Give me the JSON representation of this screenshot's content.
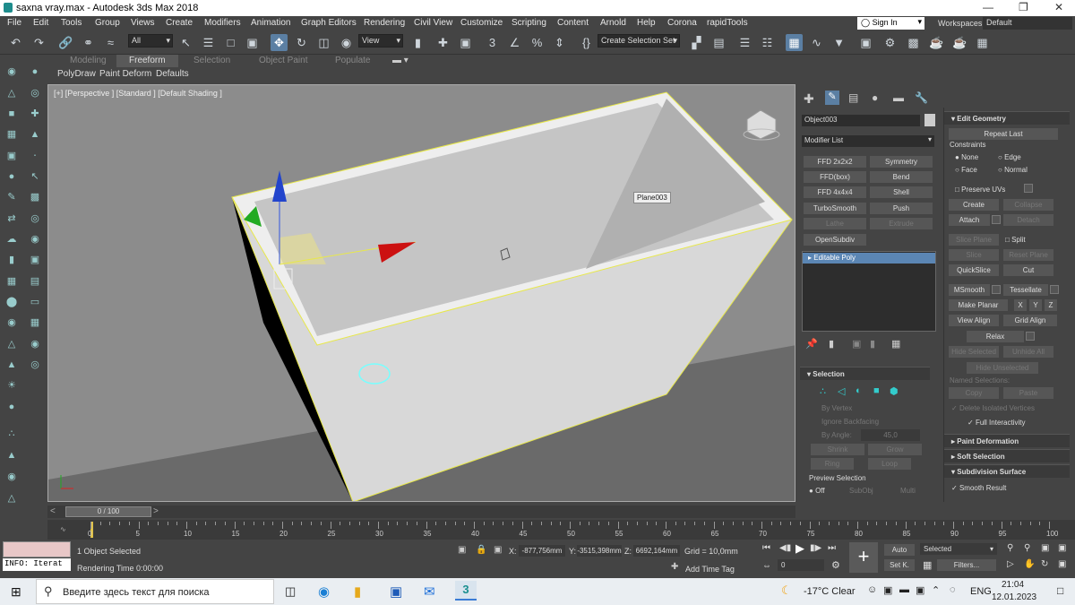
{
  "window": {
    "title": "saxna vray.max - Autodesk 3ds Max 2018"
  },
  "menu": [
    "File",
    "Edit",
    "Tools",
    "Group",
    "Views",
    "Create",
    "Modifiers",
    "Animation",
    "Graph Editors",
    "Rendering",
    "Civil View",
    "Customize",
    "Scripting",
    "Content",
    "Arnold",
    "Help",
    "Corona",
    "rapidTools"
  ],
  "account": {
    "signin": "Sign In",
    "workspaces_label": "Workspaces:",
    "workspace": "Default"
  },
  "toolbar": {
    "filter": "All",
    "view": "View",
    "selection_set": "Create Selection Set"
  },
  "ribbon": {
    "tabs": [
      "Modeling",
      "Freeform",
      "Selection",
      "Object Paint",
      "Populate"
    ],
    "subtabs": [
      "PolyDraw",
      "Paint Deform",
      "Defaults"
    ]
  },
  "viewport": {
    "label": "[+] [Perspective ] [Standard ] [Default Shading ]",
    "tooltip": "Plane003"
  },
  "command_panel": {
    "object_name": "Object003",
    "modifier_list": "Modifier List",
    "buttons": [
      [
        "FFD 2x2x2",
        "Symmetry"
      ],
      [
        "FFD(box)",
        "Bend"
      ],
      [
        "FFD 4x4x4",
        "Shell"
      ],
      [
        "TurboSmooth",
        "Push"
      ],
      [
        "Lathe",
        "Extrude"
      ],
      [
        "OpenSubdiv",
        ""
      ]
    ],
    "stack_item": "Editable Poly",
    "selection": {
      "title": "Selection",
      "by_vertex": "By Vertex",
      "ignore_backfacing": "Ignore Backfacing",
      "by_angle": "By Angle:",
      "angle": "45,0",
      "shrink": "Shrink",
      "grow": "Grow",
      "ring": "Ring",
      "loop": "Loop",
      "preview": "Preview Selection",
      "off": "Off",
      "subobj": "SubObj",
      "multi": "Multi"
    }
  },
  "edit_geometry": {
    "title": "Edit Geometry",
    "repeat_last": "Repeat Last",
    "constraints": "Constraints",
    "none": "None",
    "edge": "Edge",
    "face": "Face",
    "normal": "Normal",
    "preserve_uvs": "Preserve UVs",
    "create": "Create",
    "collapse": "Collapse",
    "attach": "Attach",
    "detach": "Detach",
    "slice_plane": "Slice Plane",
    "split": "Split",
    "slice": "Slice",
    "reset_plane": "Reset Plane",
    "quickslice": "QuickSlice",
    "cut": "Cut",
    "msmooth": "MSmooth",
    "tessellate": "Tessellate",
    "make_planar": "Make Planar",
    "x": "X",
    "y": "Y",
    "z": "Z",
    "view_align": "View Align",
    "grid_align": "Grid Align",
    "relax": "Relax",
    "hide_selected": "Hide Selected",
    "unhide_all": "Unhide All",
    "hide_unselected": "Hide Unselected",
    "named_selections": "Named Selections:",
    "copy": "Copy",
    "paste": "Paste",
    "delete_isolated": "Delete Isolated Vertices",
    "full_interactivity": "Full Interactivity"
  },
  "rollouts": {
    "paint_deformation": "Paint Deformation",
    "soft_selection": "Soft Selection",
    "subdivision_surface": "Subdivision Surface",
    "smooth_result": "Smooth Result"
  },
  "timeline": {
    "frame": "0 / 100",
    "ticks": [
      "0",
      "5",
      "10",
      "15",
      "20",
      "25",
      "30",
      "35",
      "40",
      "45",
      "50",
      "55",
      "60",
      "65",
      "70",
      "75",
      "80",
      "85",
      "90",
      "95",
      "100"
    ]
  },
  "status": {
    "selected": "1 Object Selected",
    "rendering_time": "Rendering Time  0:00:00",
    "x_label": "X:",
    "x": "-877,756mm",
    "y_label": "Y:",
    "y": "-3515,398mm",
    "z_label": "Z:",
    "z": "6692,164mm",
    "grid": "Grid = 10,0mm",
    "add_time_tag": "Add Time Tag",
    "auto": "Auto",
    "set_k": "Set K.",
    "selected_dd": "Selected",
    "filters": "Filters...",
    "frame_field": "0",
    "info": "INFO: Iterat"
  },
  "taskbar": {
    "search": "Введите здесь текст для поиска",
    "weather": "-17°C  Clear",
    "lang": "ENG",
    "time": "21:04",
    "date": "12.01.2023"
  },
  "colors": {
    "selection_yellow": "#e8e84a",
    "active_blue": "#5b7fa3"
  }
}
